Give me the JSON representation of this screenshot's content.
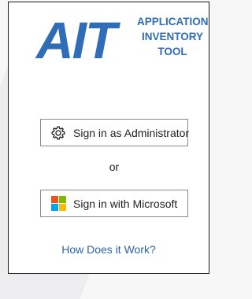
{
  "logo": {
    "mark": "AIT",
    "subtitle_lines": [
      "APPLICATION",
      "INVENTORY",
      "TOOL"
    ]
  },
  "admin_button": {
    "label": "Sign in as Administrator",
    "icon": "gear-icon"
  },
  "separator": "or",
  "microsoft_button": {
    "label": "Sign in with Microsoft",
    "icon": "microsoft-logo-icon"
  },
  "help_link": "How Does it Work?",
  "colors": {
    "brand": "#2f6db6",
    "link": "#2e62a8",
    "ms_red": "#f25022",
    "ms_green": "#7fba00",
    "ms_blue": "#00a4ef",
    "ms_yellow": "#ffb900"
  }
}
